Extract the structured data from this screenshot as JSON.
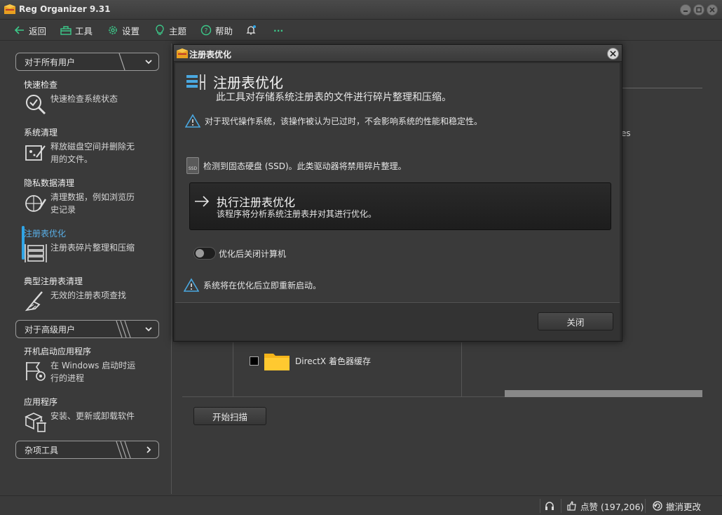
{
  "window": {
    "title": "Reg Organizer 9.31"
  },
  "toolbar": {
    "back": "返回",
    "tools": "工具",
    "settings": "设置",
    "themes": "主题",
    "help": "帮助",
    "more": "···"
  },
  "sidebar": {
    "section_all": "对于所有用户",
    "section_advanced": "对于高级用户",
    "section_misc": "杂项工具",
    "items": [
      {
        "title": "快速检查",
        "desc": "快速检查系统状态"
      },
      {
        "title": "系统清理",
        "desc": "释放磁盘空间并删除无用的文件。"
      },
      {
        "title": "隐私数据清理",
        "desc": "清理数据，例如浏览历史记录"
      },
      {
        "title": "注册表优化",
        "desc": "注册表碎片整理和压缩"
      },
      {
        "title": "典型注册表清理",
        "desc": "无效的注册表项查找"
      },
      {
        "title": "开机启动应用程序",
        "desc": "在 Windows 启动时运行的进程"
      },
      {
        "title": "应用程序",
        "desc": "安装、更新或卸载软件"
      }
    ]
  },
  "background": {
    "partial_text": "es",
    "folder_label": "DirectX 着色器缓存",
    "scan_button": "开始扫描"
  },
  "dialog": {
    "title": "注册表优化",
    "heading": "注册表优化",
    "subheading": "此工具对存储系统注册表的文件进行碎片整理和压缩。",
    "warning_modern": "对于现代操作系统，该操作被认为已过时，不会影响系统的性能和稳定性。",
    "ssd_badge": "SSD",
    "ssd_notice": "检测到固态硬盘 (SSD)。此类驱动器将禁用碎片整理。",
    "action_title": "执行注册表优化",
    "action_desc": "该程序将分析系统注册表并对其进行优化。",
    "shutdown_label": "优化后关闭计算机",
    "restart_notice": "系统将在优化后立即重新启动。",
    "close_button": "关闭"
  },
  "status": {
    "likes": "点赞 (197,206)",
    "undo": "撤消更改"
  },
  "colors": {
    "accent": "#2fa5e6",
    "warning": "#4aa8e0",
    "folder": "#f4b41a"
  }
}
